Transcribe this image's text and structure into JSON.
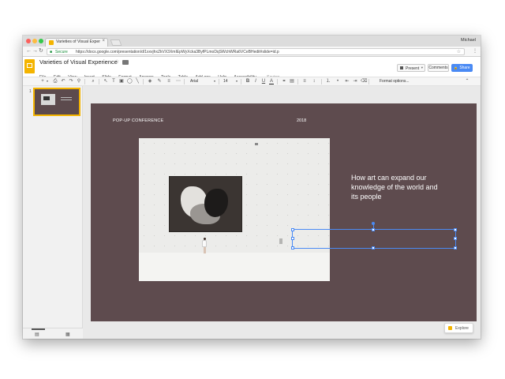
{
  "browser": {
    "tab_title": "Varieties of Visual Experience",
    "tab_close": "×",
    "user_name": "Michael",
    "secure_label": "Secure",
    "url": "https://docs.google.com/presentation/d/1xxvjhxZkVX3XmIEpWyXcka3ByfPLmoDqSWchWRa6VCeBHedit#slide=id.p",
    "back": "←",
    "forward": "→",
    "reload": "↻",
    "bookmark_star": "☆",
    "menu": "⋮",
    "colors": {
      "close": "#fc605c",
      "minimize": "#fdbc40",
      "maximize": "#34c84a"
    }
  },
  "docs": {
    "title": "Varieties of Visual Experience",
    "title_star": "☆",
    "menus": [
      "File",
      "Edit",
      "View",
      "Insert",
      "Slide",
      "Format",
      "Arrange",
      "Tools",
      "Table",
      "Add-ons",
      "Help",
      "Accessibility"
    ],
    "saving": "Saving...",
    "present_label": "Present",
    "present_caret": "▾",
    "comments_label": "Comments",
    "share_label": "Share",
    "share_lock": "🔒"
  },
  "toolbar": {
    "font_name": "Arial",
    "font_size": "14",
    "bold": "B",
    "italic": "I",
    "underline": "U",
    "text_color": "A",
    "format_options": "Format options...",
    "collapse": "⌃",
    "plus": "+",
    "caret": "▾",
    "print": "⎙",
    "undo": "↶",
    "redo": "↷",
    "paint": "⚲",
    "zoom": "⌕",
    "select": "↖",
    "textbox": "T",
    "image": "▣",
    "shape": "◯",
    "line": "╲",
    "fill": "◈",
    "border_color": "✎",
    "border_weight": "≡",
    "border_dash": "⋯",
    "link": "⚭",
    "comment": "▤",
    "align": "≡",
    "line_spacing": "↕",
    "numbered_list": "⒈",
    "bulleted_list": "•",
    "indent_less": "⇤",
    "indent_more": "⇥",
    "clear_format": "⌫"
  },
  "filmstrip": {
    "slide_number": "1",
    "grid_view": "▦",
    "filmstrip_view": "▤"
  },
  "slide": {
    "conference": "POP-UP CONFERENCE",
    "year": "2018",
    "heading": "How art can expand our knowledge of the world and its people"
  },
  "explore": {
    "label": "Explore",
    "icon": "✦"
  }
}
